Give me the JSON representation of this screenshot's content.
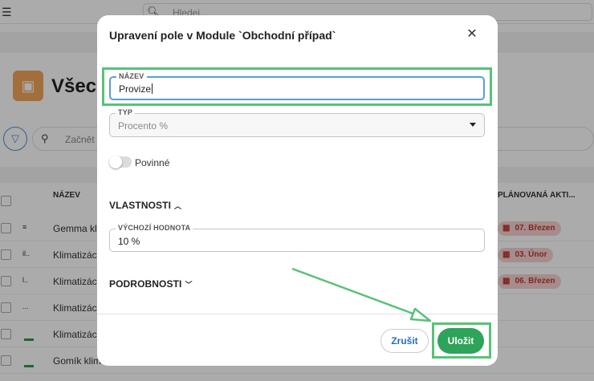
{
  "background": {
    "search_placeholder": "Hledej...",
    "module_title": "Všech",
    "list_search_placeholder": "Začnět",
    "columns": {
      "name": "NÁZEV",
      "planned_activity": "PLÁNOVANÁ AKTI..."
    },
    "rows": [
      {
        "mark": "≡",
        "name": "Gemma kl",
        "badge": "07. Březen"
      },
      {
        "mark": "il..",
        "name": "Klimatizác",
        "badge": "03. Únor"
      },
      {
        "mark": "l..",
        "name": "Klimatizác",
        "badge": "06. Březen"
      },
      {
        "mark": "...",
        "name": "Klimatizác",
        "badge": ""
      },
      {
        "mark": "",
        "name": "Klimatizác",
        "badge": ""
      },
      {
        "mark": "",
        "name": "Gomík klim",
        "badge": ""
      }
    ]
  },
  "modal": {
    "title": "Upravení pole v Module `Obchodní případ`",
    "name_field": {
      "label": "NÁZEV",
      "value": "Provize"
    },
    "type_field": {
      "label": "TYP",
      "value": "Procento %"
    },
    "required_toggle": {
      "label": "Povinné",
      "on": false
    },
    "properties_section": {
      "label": "VLASTNOSTI",
      "expanded": true
    },
    "default_field": {
      "label": "VÝCHOZÍ HODNOTA",
      "value": "10 %"
    },
    "details_section": {
      "label": "PODROBNOSTI",
      "expanded": false
    },
    "cancel_label": "Zrušit",
    "save_label": "Uložit"
  },
  "colors": {
    "accent_green": "#2ea35a",
    "annotation_green": "#58c278",
    "link_blue": "#2a6db5",
    "badge_red": "#c0392b"
  }
}
